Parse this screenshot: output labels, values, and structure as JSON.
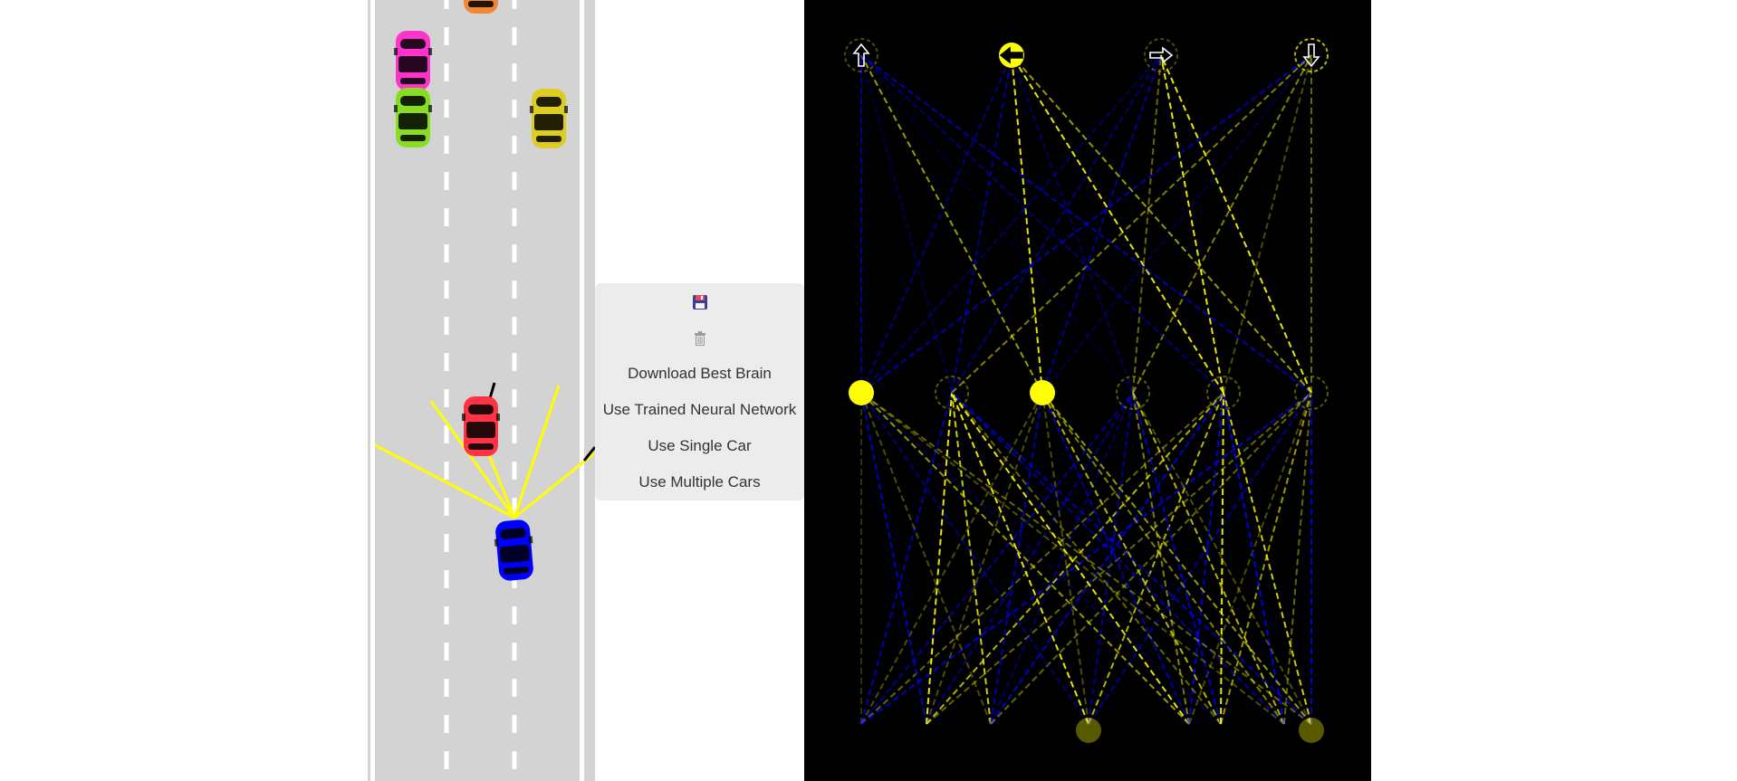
{
  "controls": {
    "save_icon": "floppy-disk-icon",
    "discard_icon": "trash-can-icon",
    "download_label": "Download Best Brain",
    "trained_label": "Use Trained Neural Network",
    "single_label": "Use Single Car",
    "multiple_label": "Use Multiple Cars"
  },
  "road": {
    "lane_count": 3,
    "surface_color": "#d3d3d3",
    "line_color": "#ffffff",
    "ray_color": "#ffff00",
    "ray_hit_color": "#000000",
    "player_car": {
      "color": "#0000ff",
      "lane": "middle"
    },
    "traffic": [
      {
        "color": "#ff33cc",
        "lane": "left"
      },
      {
        "color": "#88dd22",
        "lane": "left"
      },
      {
        "color": "#ddcc22",
        "lane": "right"
      },
      {
        "color": "#ff3344",
        "lane": "middle"
      },
      {
        "color": "#ee8833",
        "lane": "middle"
      }
    ]
  },
  "network": {
    "background": "#000000",
    "positive_color": "#ffff00",
    "negative_color": "#0000ff",
    "output_icons": [
      "up-arrow-icon",
      "left-arrow-icon",
      "right-arrow-icon",
      "down-arrow-icon"
    ],
    "output_values": [
      0,
      1,
      0,
      0
    ],
    "hidden_values": [
      1,
      0,
      1,
      0,
      0,
      0
    ],
    "input_values": [
      0,
      0,
      0,
      0,
      0.3,
      0,
      0,
      0.3
    ]
  }
}
